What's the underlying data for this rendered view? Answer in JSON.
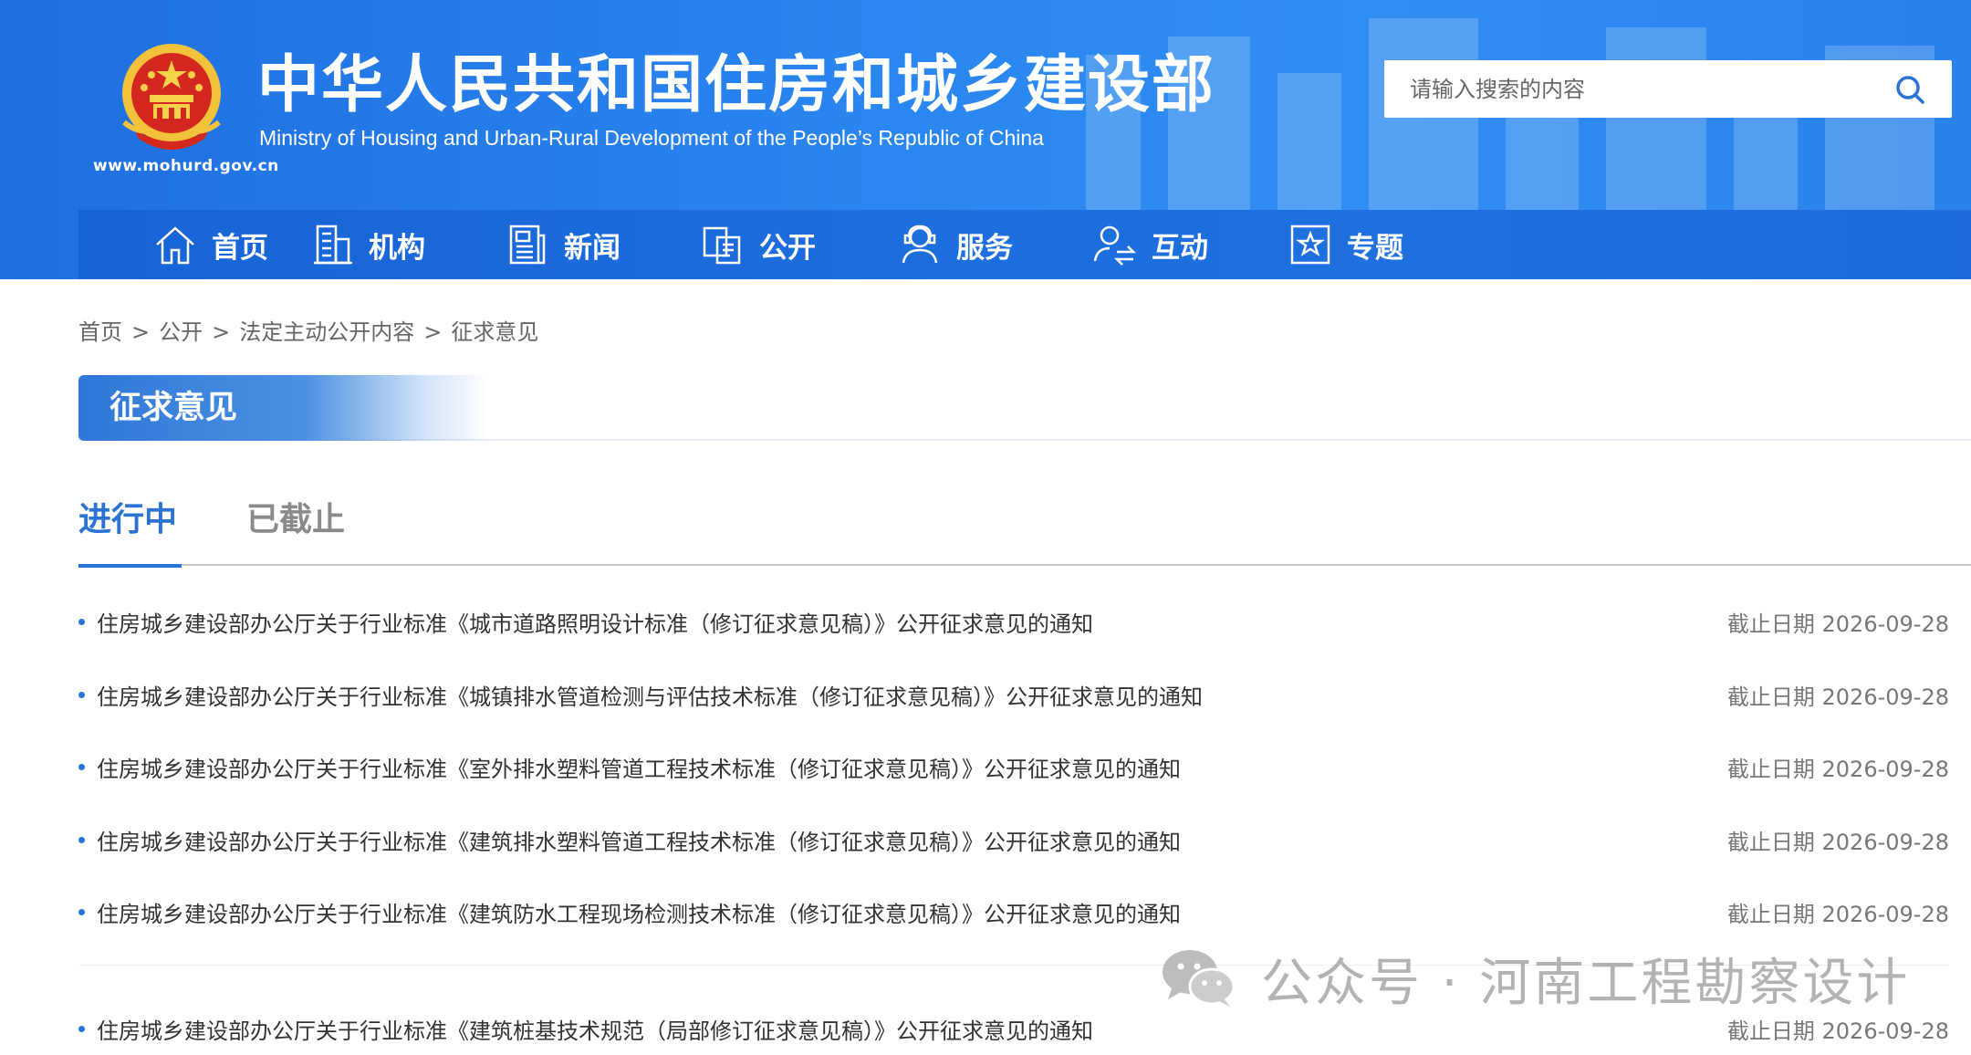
{
  "header": {
    "title_cn": "中华人民共和国住房和城乡建设部",
    "title_en": "Ministry of Housing and Urban-Rural Development of the People’s Republic of China",
    "site_url": "www.mohurd.gov.cn",
    "emblem_icon": "national-emblem-icon",
    "search_placeholder": "请输入搜索的内容",
    "search_icon": "search-icon",
    "brand_color": "#2a86f0"
  },
  "nav": {
    "items": [
      {
        "label": "首页",
        "icon": "home-icon"
      },
      {
        "label": "机构",
        "icon": "building-icon"
      },
      {
        "label": "新闻",
        "icon": "news-icon"
      },
      {
        "label": "公开",
        "icon": "disclosure-icon"
      },
      {
        "label": "服务",
        "icon": "service-icon"
      },
      {
        "label": "互动",
        "icon": "interaction-icon"
      },
      {
        "label": "专题",
        "icon": "topic-star-icon"
      }
    ]
  },
  "breadcrumb": {
    "items": [
      "首页",
      "公开",
      "法定主动公开内容",
      "征求意见"
    ],
    "separator": ">"
  },
  "section": {
    "title": "征求意见"
  },
  "tabs": {
    "items": [
      {
        "label": "进行中",
        "active": true
      },
      {
        "label": "已截止",
        "active": false
      }
    ],
    "active_color": "#2a73d4"
  },
  "list": {
    "items": [
      {
        "title": "住房城乡建设部办公厅关于行业标准《城市道路照明设计标准（修订征求意见稿）》公开征求意见的通知",
        "date": "截止日期 2026-09-28"
      },
      {
        "title": "住房城乡建设部办公厅关于行业标准《城镇排水管道检测与评估技术标准（修订征求意见稿）》公开征求意见的通知",
        "date": "截止日期 2026-09-28"
      },
      {
        "title": "住房城乡建设部办公厅关于行业标准《室外排水塑料管道工程技术标准（修订征求意见稿）》公开征求意见的通知",
        "date": "截止日期 2026-09-28"
      },
      {
        "title": "住房城乡建设部办公厅关于行业标准《建筑排水塑料管道工程技术标准（修订征求意见稿）》公开征求意见的通知",
        "date": "截止日期 2026-09-28"
      },
      {
        "title": "住房城乡建设部办公厅关于行业标准《建筑防水工程现场检测技术标准（修订征求意见稿）》公开征求意见的通知",
        "date": "截止日期 2026-09-28"
      },
      {
        "title": "住房城乡建设部办公厅关于行业标准《建筑桩基技术规范（局部修订征求意见稿）》公开征求意见的通知",
        "date": "截止日期 2026-09-28"
      }
    ]
  },
  "watermark": {
    "icon": "wechat-icon",
    "text": "公众号 · 河南工程勘察设计"
  }
}
